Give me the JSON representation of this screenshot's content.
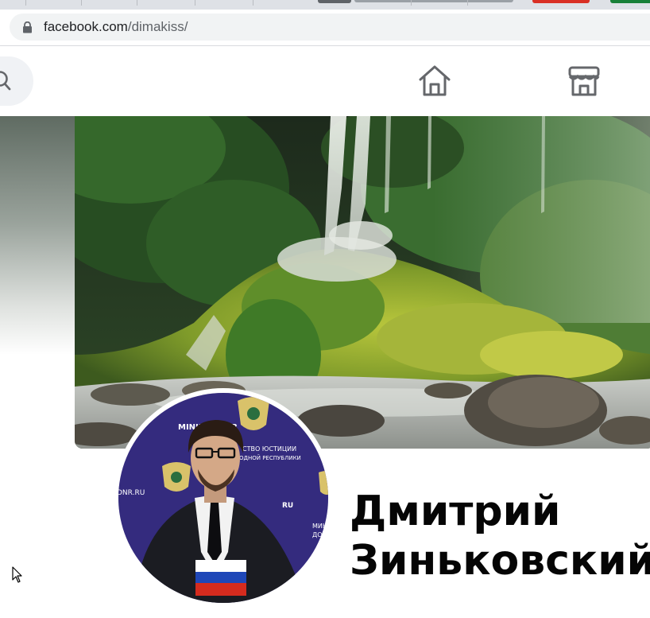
{
  "browser": {
    "url_host": "facebook.com",
    "url_path": "/dimakiss/"
  },
  "nav": {
    "search_icon": "search-icon",
    "home_icon": "home-icon",
    "marketplace_icon": "marketplace-icon"
  },
  "profile": {
    "first_name": "Дмитрий",
    "last_name": "Зиньковский",
    "avatar_texts": {
      "minjust": "MINJUST-DNR",
      "ministry": "СТВО ЮСТИЦИИ",
      "republic": "ОДНОЙ РЕСПУБЛИКИ",
      "dnr_ru": "DNR.RU",
      "ru": "RU",
      "mini": "МИНИ",
      "donetsk": "ДОНЕЦ"
    }
  },
  "colors": {
    "tabstrip": "#dee1e6",
    "omnibox": "#f1f3f4",
    "name_text": "#050505",
    "avatar_backdrop": "#3a2f86"
  }
}
